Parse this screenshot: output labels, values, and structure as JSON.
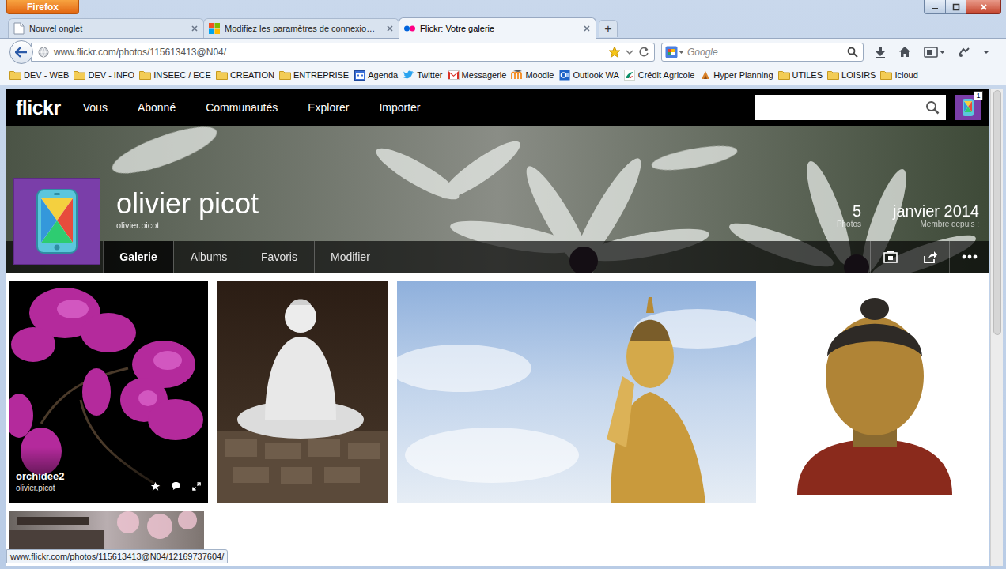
{
  "browser": {
    "app_button": "Firefox"
  },
  "tabs": [
    {
      "label": "Nouvel onglet",
      "selected": false,
      "kind": "blank"
    },
    {
      "label": "Modifiez les paramètres de connexio…",
      "selected": false,
      "kind": "windows"
    },
    {
      "label": "Flickr: Votre galerie",
      "selected": true,
      "kind": "flickr"
    }
  ],
  "new_tab": "+",
  "address_bar": {
    "url": "www.flickr.com/photos/115613413@N04/"
  },
  "search": {
    "placeholder": "Google"
  },
  "bookmarks": [
    {
      "label": "DEV - WEB",
      "kind": "folder"
    },
    {
      "label": "DEV - INFO",
      "kind": "folder"
    },
    {
      "label": "INSEEC / ECE",
      "kind": "folder"
    },
    {
      "label": "CREATION",
      "kind": "folder"
    },
    {
      "label": "ENTREPRISE",
      "kind": "folder"
    },
    {
      "label": "Agenda",
      "kind": "agenda"
    },
    {
      "label": "Twitter",
      "kind": "twitter"
    },
    {
      "label": "Messagerie",
      "kind": "mail"
    },
    {
      "label": "Moodle",
      "kind": "moodle"
    },
    {
      "label": "Outlook WA",
      "kind": "outlook"
    },
    {
      "label": "Crédit Agricole",
      "kind": "bank"
    },
    {
      "label": "Hyper Planning",
      "kind": "planning"
    },
    {
      "label": "UTILES",
      "kind": "folder"
    },
    {
      "label": "LOISIRS",
      "kind": "folder"
    },
    {
      "label": "Icloud",
      "kind": "folder"
    }
  ],
  "flickr": {
    "logo": "flickr",
    "nav": [
      "Vous",
      "Abonné",
      "Communautés",
      "Explorer",
      "Importer"
    ],
    "notifications": "1",
    "profile": {
      "name": "olivier picot",
      "username": "olivier.picot",
      "photo_count": "5",
      "photo_label": "Photos",
      "member_since": "janvier 2014",
      "member_label": "Membre depuis :"
    },
    "subnav": [
      {
        "label": "Galerie",
        "selected": true
      },
      {
        "label": "Albums",
        "selected": false
      },
      {
        "label": "Favoris",
        "selected": false
      },
      {
        "label": "Modifier",
        "selected": false
      }
    ],
    "photos": [
      {
        "kind": "orchid",
        "hover": true,
        "title": "orchidee2",
        "owner": "olivier.picot"
      },
      {
        "kind": "statue-white",
        "hover": false
      },
      {
        "kind": "statue-sky",
        "hover": false
      },
      {
        "kind": "bust",
        "hover": false
      },
      {
        "kind": "temple",
        "hover": false
      }
    ]
  },
  "status_bar": "www.flickr.com/photos/115613413@N04/12169737604/"
}
